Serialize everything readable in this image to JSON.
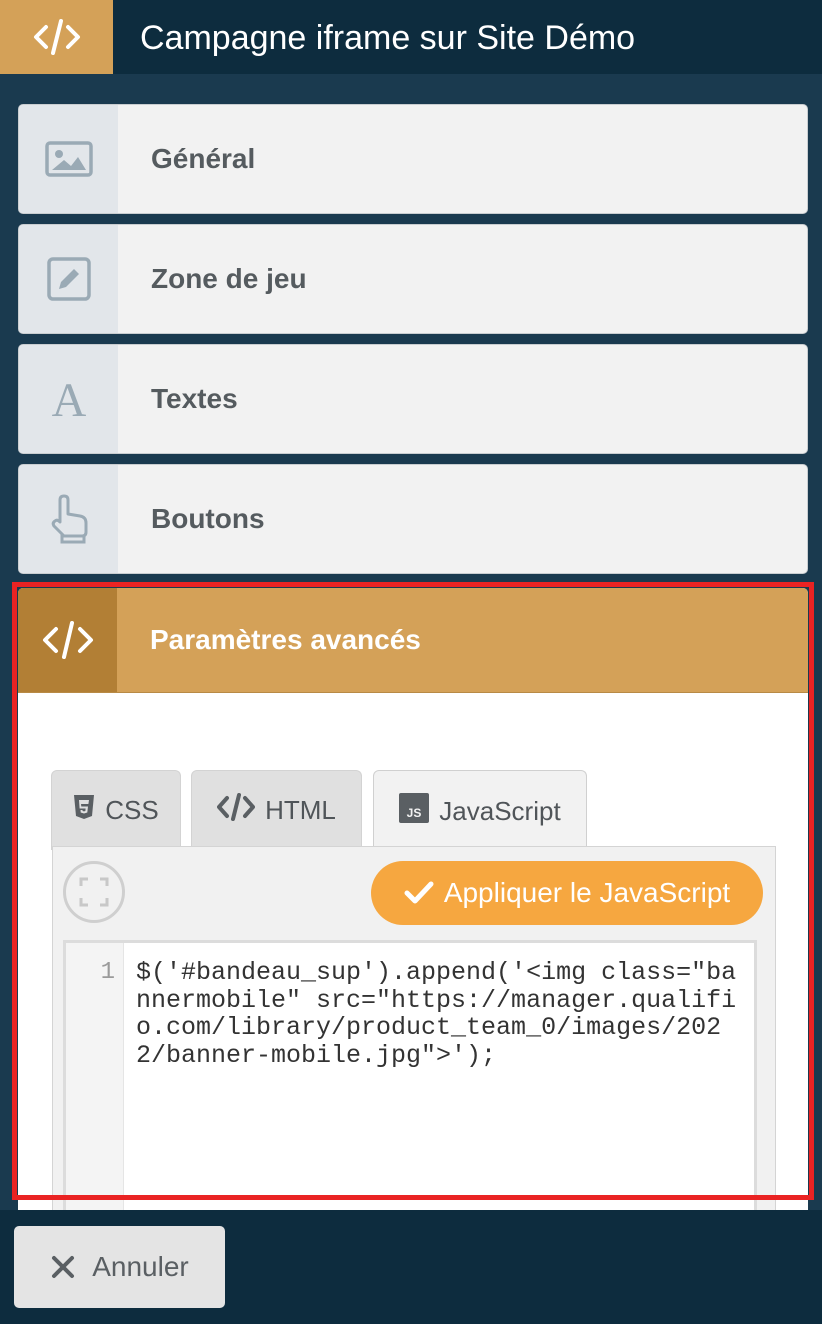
{
  "header": {
    "title": "Campagne iframe sur Site Démo",
    "icon": "code-icon",
    "accent_color": "#d4a158"
  },
  "sections": [
    {
      "label": "Général",
      "icon": "image-icon"
    },
    {
      "label": "Zone de jeu",
      "icon": "edit-icon"
    },
    {
      "label": "Textes",
      "icon": "font-icon"
    },
    {
      "label": "Boutons",
      "icon": "pointer-hand-icon"
    }
  ],
  "advanced": {
    "label": "Paramètres avancés",
    "icon": "code-icon",
    "tabs": [
      {
        "label": "CSS",
        "icon": "css3-icon",
        "active": false
      },
      {
        "label": "HTML",
        "icon": "code-icon",
        "active": false
      },
      {
        "label": "JavaScript",
        "icon": "js-icon",
        "active": true
      }
    ],
    "apply_label": "Appliquer le JavaScript",
    "apply_color": "#f6a740",
    "editor": {
      "line_number": "1",
      "code": "$('#bandeau_sup').append('<img class=\"bannermobile\" src=\"https://manager.qualifio.com/library/product_team_0/images/2022/banner-mobile.jpg\">');"
    }
  },
  "footer": {
    "cancel_label": "Annuler"
  }
}
